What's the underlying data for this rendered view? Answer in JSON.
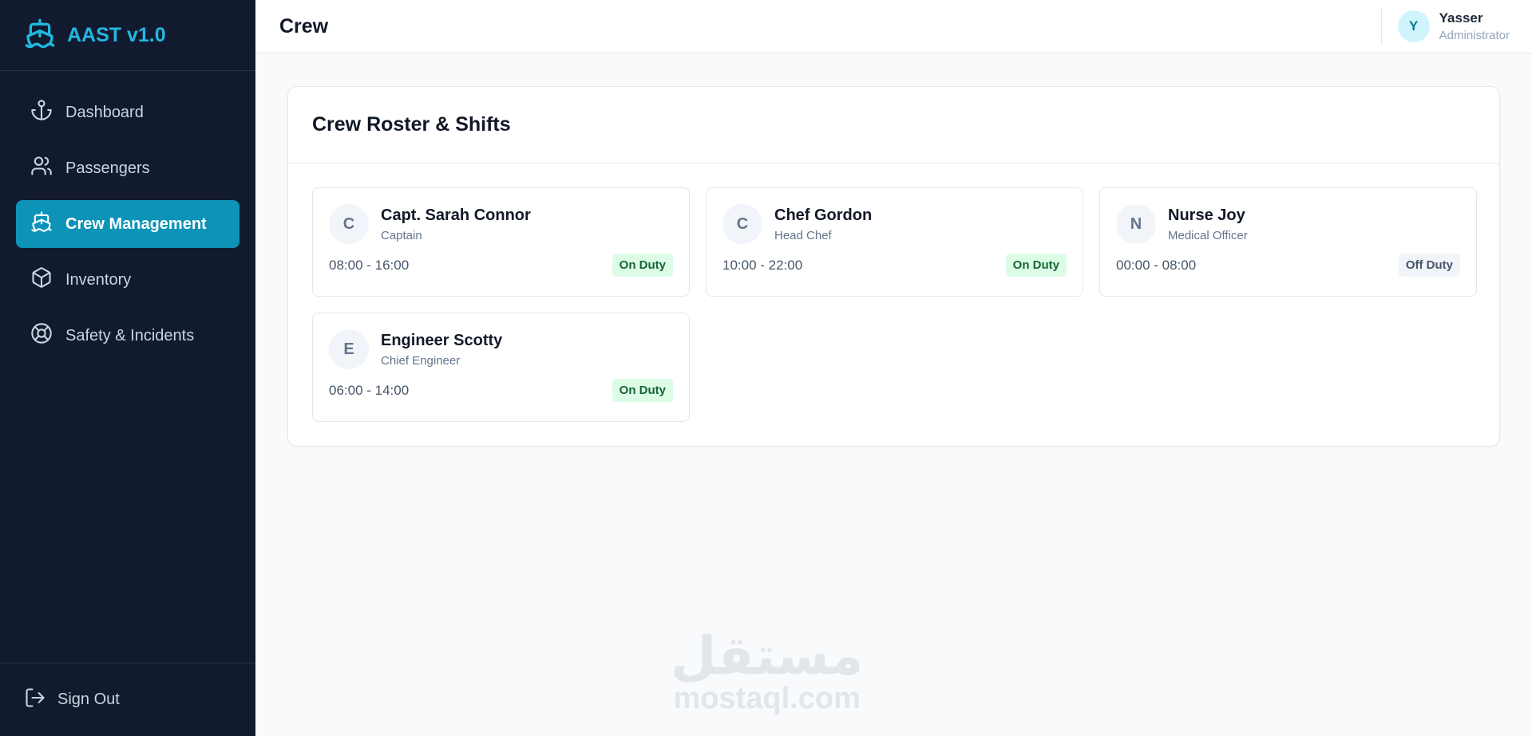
{
  "brand": {
    "title": "AAST v1.0",
    "icon": "ship-icon"
  },
  "sidebar": {
    "items": [
      {
        "label": "Dashboard",
        "icon": "anchor-icon",
        "active": false
      },
      {
        "label": "Passengers",
        "icon": "users-icon",
        "active": false
      },
      {
        "label": "Crew Management",
        "icon": "ship-icon",
        "active": true
      },
      {
        "label": "Inventory",
        "icon": "box-icon",
        "active": false
      },
      {
        "label": "Safety & Incidents",
        "icon": "life-buoy-icon",
        "active": false
      }
    ],
    "signout": {
      "label": "Sign Out",
      "icon": "logout-icon"
    }
  },
  "header": {
    "title": "Crew"
  },
  "user": {
    "initial": "Y",
    "name": "Yasser",
    "role": "Administrator"
  },
  "main": {
    "card_title": "Crew Roster & Shifts",
    "crew": [
      {
        "initial": "C",
        "name": "Capt. Sarah Connor",
        "role": "Captain",
        "shift": "08:00 - 16:00",
        "status": "On Duty"
      },
      {
        "initial": "C",
        "name": "Chef Gordon",
        "role": "Head Chef",
        "shift": "10:00 - 22:00",
        "status": "On Duty"
      },
      {
        "initial": "N",
        "name": "Nurse Joy",
        "role": "Medical Officer",
        "shift": "00:00 - 08:00",
        "status": "Off Duty"
      },
      {
        "initial": "E",
        "name": "Engineer Scotty",
        "role": "Chief Engineer",
        "shift": "06:00 - 14:00",
        "status": "On Duty"
      }
    ]
  },
  "watermark": {
    "arabic": "مستقل",
    "latin": "mostaql.com"
  },
  "colors": {
    "sidebar_bg": "#111a2e",
    "accent": "#0e93b8",
    "brand": "#22b8e0",
    "on_duty_bg": "#dcfce7",
    "on_duty_text": "#166534",
    "off_duty_bg": "#f1f5f9"
  }
}
